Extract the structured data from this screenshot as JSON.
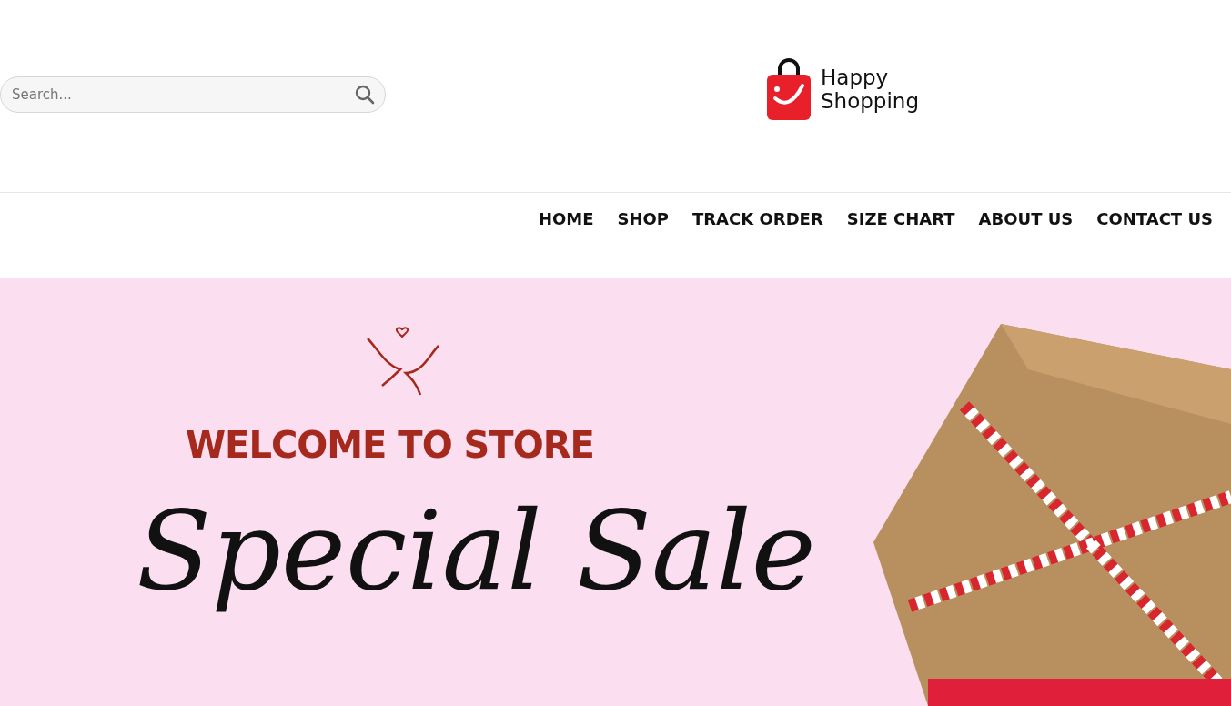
{
  "header": {
    "search": {
      "placeholder": "Search..."
    },
    "logo": {
      "line_1": "Happy",
      "line_2": "Shopping"
    }
  },
  "nav": {
    "items": [
      {
        "label": "HOME"
      },
      {
        "label": "SHOP"
      },
      {
        "label": "TRACK ORDER"
      },
      {
        "label": "SIZE CHART"
      },
      {
        "label": "ABOUT US"
      },
      {
        "label": "CONTACT US"
      }
    ]
  },
  "hero": {
    "kicker": "WELCOME TO STORE",
    "headline": "Special Sale"
  }
}
